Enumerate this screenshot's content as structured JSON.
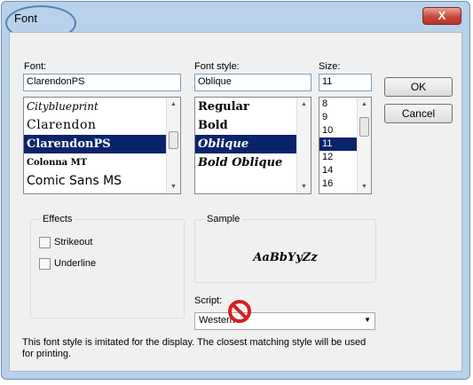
{
  "window": {
    "title": "Font",
    "close_glyph": "X"
  },
  "font": {
    "label": "Font:",
    "value": "ClarendonPS",
    "items": [
      {
        "label": "Cityblueprint",
        "style": "script"
      },
      {
        "label": "Clarendon",
        "style": "plain"
      },
      {
        "label": "ClarendonPS",
        "style": "bold",
        "selected": true
      },
      {
        "label": "Colonna MT",
        "style": "smallbold"
      },
      {
        "label": "Comic Sans MS",
        "style": "comic"
      }
    ]
  },
  "style": {
    "label": "Font style:",
    "value": "Oblique",
    "items": [
      {
        "label": "Regular",
        "style": "bold"
      },
      {
        "label": "Bold",
        "style": "bold"
      },
      {
        "label": "Oblique",
        "style": "bolditalic",
        "selected": true
      },
      {
        "label": "Bold Oblique",
        "style": "bolditalic"
      }
    ]
  },
  "size": {
    "label": "Size:",
    "value": "11",
    "items": [
      {
        "label": "8"
      },
      {
        "label": "9"
      },
      {
        "label": "10"
      },
      {
        "label": "11",
        "selected": true
      },
      {
        "label": "12"
      },
      {
        "label": "14"
      },
      {
        "label": "16"
      }
    ]
  },
  "buttons": {
    "ok": "OK",
    "cancel": "Cancel"
  },
  "effects": {
    "title": "Effects",
    "strikeout": "Strikeout",
    "underline": "Underline"
  },
  "sample": {
    "title": "Sample",
    "text": "AaBbYyZz"
  },
  "script": {
    "label": "Script:",
    "value": "Western"
  },
  "hint": "This font style is imitated for the display. The closest matching style will be used for printing.",
  "colors": {
    "selection": "#0a246a",
    "no_symbol": "#d81e1e",
    "title_ring": "#5a7fb5"
  }
}
